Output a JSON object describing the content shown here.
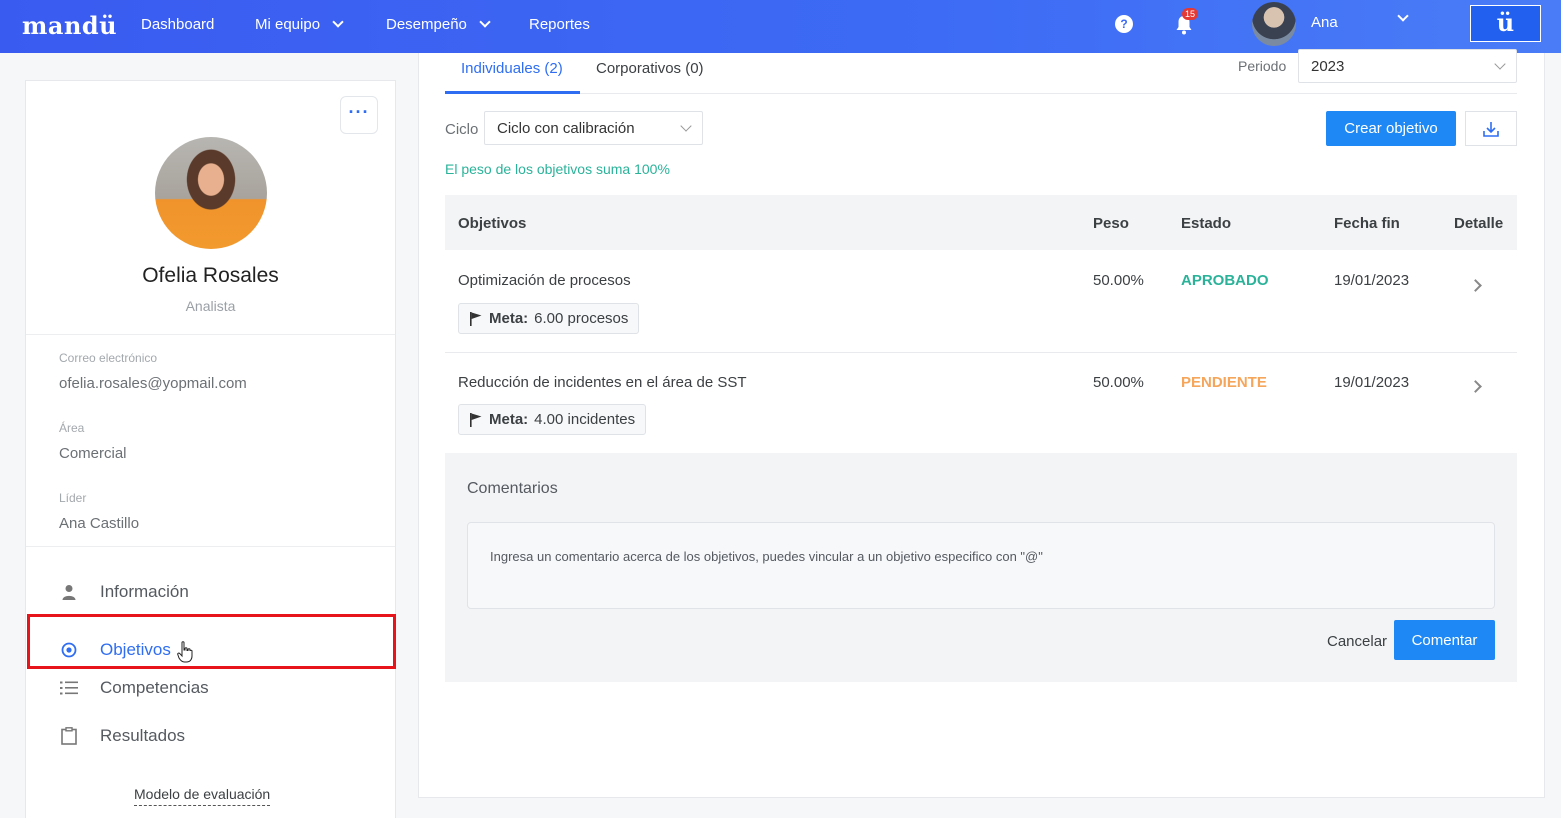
{
  "topbar": {
    "logo": "mandü",
    "nav": {
      "dashboard": "Dashboard",
      "mi_equipo": "Mi equipo",
      "desempeno": "Desempeño",
      "reportes": "Reportes"
    },
    "help": "?",
    "notification_count": "15",
    "user_name": "Ana",
    "brand_button": "ü"
  },
  "profile": {
    "more": "···",
    "name": "Ofelia Rosales",
    "role": "Analista",
    "email_label": "Correo electrónico",
    "email": "ofelia.rosales@yopmail.com",
    "area_label": "Área",
    "area": "Comercial",
    "leader_label": "Líder",
    "leader": "Ana Castillo",
    "menu": {
      "informacion": "Información",
      "objetivos": "Objetivos",
      "competencias": "Competencias",
      "resultados": "Resultados"
    },
    "model_link": "Modelo de evaluación"
  },
  "main": {
    "tabs": {
      "individuales": "Individuales (2)",
      "corporativos": "Corporativos (0)"
    },
    "periodo_label": "Periodo",
    "periodo_value": "2023",
    "ciclo_label": "Ciclo",
    "ciclo_value": "Ciclo con calibración",
    "create_button": "Crear objetivo",
    "weight_note": "El peso de los objetivos suma 100%",
    "table": {
      "headers": {
        "objetivos": "Objetivos",
        "peso": "Peso",
        "estado": "Estado",
        "fecha_fin": "Fecha fin",
        "detalle": "Detalle"
      },
      "rows": [
        {
          "objetivo": "Optimización de procesos",
          "meta_label": "Meta:",
          "meta_value": "6.00 procesos",
          "peso": "50.00%",
          "estado": "APROBADO",
          "fecha_fin": "19/01/2023"
        },
        {
          "objetivo": "Reducción de incidentes en el área de SST",
          "meta_label": "Meta:",
          "meta_value": "4.00 incidentes",
          "peso": "50.00%",
          "estado": "PENDIENTE",
          "fecha_fin": "19/01/2023"
        }
      ]
    },
    "comments": {
      "title": "Comentarios",
      "placeholder": "Ingresa un comentario acerca de los objetivos, puedes vincular a un objetivo especifico con \"@\"",
      "cancel": "Cancelar",
      "submit": "Comentar"
    }
  },
  "colors": {
    "brand": "#3d6bf5",
    "primary_button": "#1e88f5",
    "approved": "#2bb39a",
    "pending": "#f5a65b",
    "highlight": "#e8141c"
  }
}
